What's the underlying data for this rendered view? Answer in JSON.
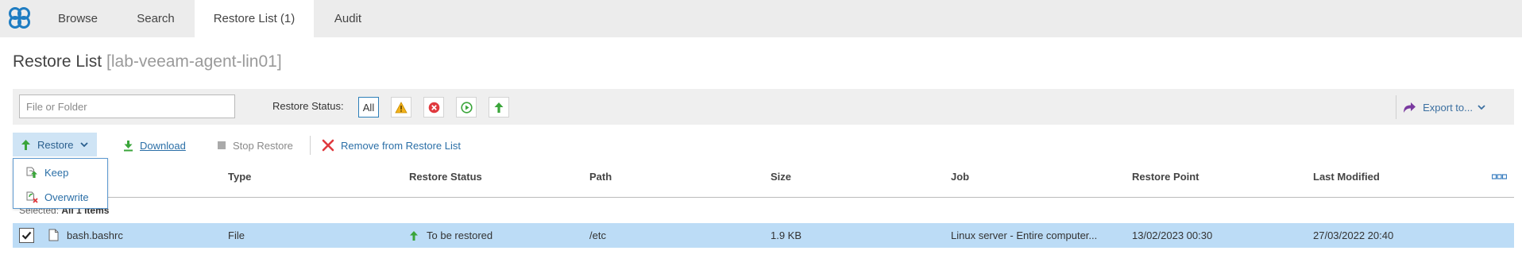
{
  "nav": {
    "tabs": [
      "Browse",
      "Search",
      "Restore List (1)",
      "Audit"
    ],
    "active_index": 2
  },
  "title": {
    "text": "Restore List",
    "host": "[lab-veeam-agent-lin01]"
  },
  "filter": {
    "search_placeholder": "File or Folder",
    "status_label": "Restore Status:",
    "all_label": "All",
    "export_label": "Export to..."
  },
  "toolbar": {
    "restore_label": "Restore",
    "download_label": "Download",
    "stop_label": "Stop Restore",
    "remove_label": "Remove from Restore List"
  },
  "restore_menu": {
    "keep": "Keep",
    "overwrite": "Overwrite"
  },
  "table": {
    "columns": {
      "type": "Type",
      "status": "Restore Status",
      "path": "Path",
      "size": "Size",
      "job": "Job",
      "restore_point": "Restore Point",
      "modified": "Last Modified"
    },
    "selected_prefix": "Selected:",
    "selected_value": "All 1 items",
    "rows": [
      {
        "name": "bash.bashrc",
        "type": "File",
        "status": "To be restored",
        "path": "/etc",
        "size": "1.9 KB",
        "job": "Linux server - Entire computer...",
        "restore_point": "13/02/2023 00:30",
        "modified": "27/03/2022 20:40"
      }
    ]
  },
  "colors": {
    "accent": "#2b6fa7",
    "selected_row": "#bcdcf6",
    "restore_button": "#cfe4f5",
    "green": "#3aa53a",
    "red": "#e0393e"
  }
}
